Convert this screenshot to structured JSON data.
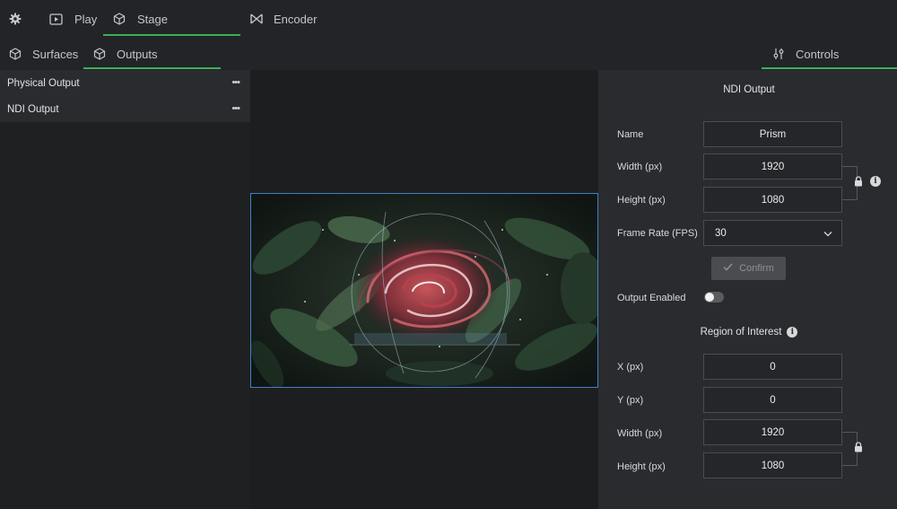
{
  "topbar": {
    "tabs": [
      {
        "label": "Play",
        "icon": "play-square-icon"
      },
      {
        "label": "Stage",
        "icon": "cube-icon",
        "active": true
      },
      {
        "label": "Encoder",
        "icon": "bowtie-icon"
      }
    ],
    "settings_icon": "gear-icon"
  },
  "subbar": {
    "tabs": [
      {
        "label": "Surfaces",
        "icon": "cube-icon"
      },
      {
        "label": "Outputs",
        "icon": "cube-icon",
        "active": true
      },
      {
        "label": "Controls",
        "icon": "sliders-icon",
        "active": true
      }
    ]
  },
  "outputs": [
    {
      "label": "Physical Output",
      "menu": "•••"
    },
    {
      "label": "NDI Output",
      "menu": "•••"
    }
  ],
  "panel": {
    "title": "NDI Output",
    "name_label": "Name",
    "name_value": "Prism",
    "width_label": "Width (px)",
    "width_value": "1920",
    "height_label": "Height (px)",
    "height_value": "1080",
    "fps_label": "Frame Rate (FPS)",
    "fps_value": "30",
    "confirm_label": "Confirm",
    "output_enabled_label": "Output Enabled",
    "output_enabled": false,
    "roi_title": "Region of Interest",
    "x_label": "X (px)",
    "x_value": "0",
    "y_label": "Y (px)",
    "y_value": "0",
    "roi_width_label": "Width (px)",
    "roi_width_value": "1920",
    "roi_height_label": "Height (px)",
    "roi_height_value": "1080",
    "info_glyph": "i"
  },
  "colors": {
    "accent": "#3fae5a",
    "selection": "#3f7fc8",
    "panel_bg": "#2a2b2e",
    "app_bg": "#1d1e20"
  }
}
